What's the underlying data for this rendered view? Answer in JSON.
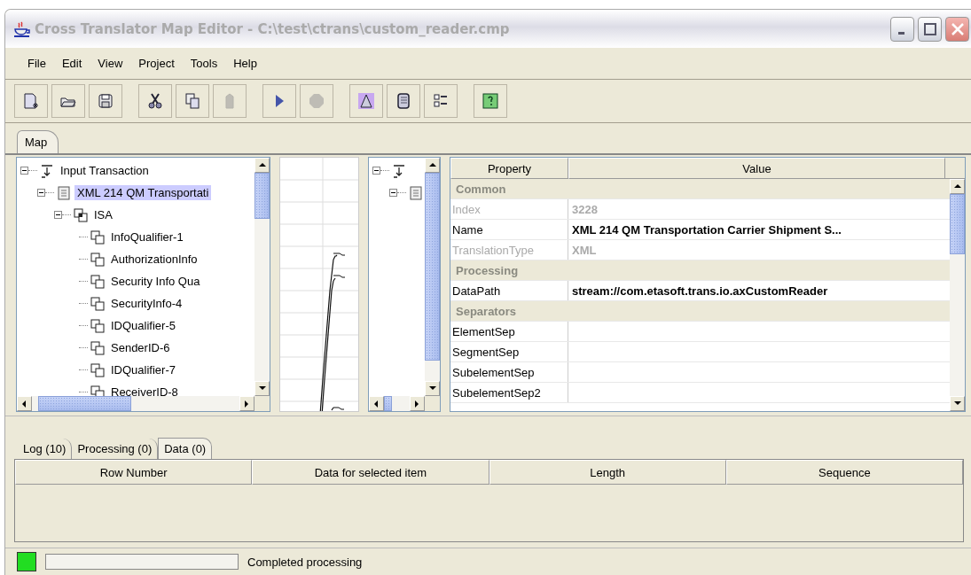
{
  "window": {
    "title": "Cross Translator Map Editor - C:\\test\\ctrans\\custom_reader.cmp"
  },
  "menu": [
    "File",
    "Edit",
    "View",
    "Project",
    "Tools",
    "Help"
  ],
  "toolbar": [
    {
      "kind": "new",
      "disabled": false
    },
    {
      "kind": "open",
      "disabled": false
    },
    {
      "kind": "save",
      "disabled": false
    },
    {
      "kind": "sep"
    },
    {
      "kind": "cut",
      "disabled": false
    },
    {
      "kind": "copy",
      "disabled": false
    },
    {
      "kind": "paste",
      "disabled": true
    },
    {
      "kind": "sep"
    },
    {
      "kind": "run",
      "disabled": false
    },
    {
      "kind": "stop",
      "disabled": true
    },
    {
      "kind": "sep"
    },
    {
      "kind": "map",
      "disabled": false
    },
    {
      "kind": "book",
      "disabled": false
    },
    {
      "kind": "list",
      "disabled": false
    },
    {
      "kind": "sep"
    },
    {
      "kind": "help",
      "disabled": false
    }
  ],
  "tabs": [
    {
      "label": "Map",
      "selected": true
    }
  ],
  "source_tree": [
    {
      "kind": "transaction",
      "label": "Input Transaction",
      "expanded": true,
      "selected": false,
      "children": [
        {
          "kind": "document",
          "label": "XML 214 QM Transportati",
          "expanded": true,
          "selected": true,
          "children": [
            {
              "kind": "segment",
              "label": "ISA",
              "expanded": true,
              "selected": false,
              "children": [
                {
                  "kind": "element",
                  "label": "InfoQualifier-1",
                  "selected": false
                },
                {
                  "kind": "element",
                  "label": "AuthorizationInfo",
                  "selected": false
                },
                {
                  "kind": "element",
                  "label": "Security Info Qua",
                  "selected": false
                },
                {
                  "kind": "element",
                  "label": "SecurityInfo-4",
                  "selected": false
                },
                {
                  "kind": "element",
                  "label": "IDQualifier-5",
                  "selected": false
                },
                {
                  "kind": "element",
                  "label": "SenderID-6",
                  "selected": false
                },
                {
                  "kind": "element",
                  "label": "IDQualifier-7",
                  "selected": false
                },
                {
                  "kind": "element",
                  "label": "ReceiverID-8",
                  "selected": false
                }
              ]
            }
          ]
        }
      ]
    }
  ],
  "target_tree": [
    {
      "kind": "transaction",
      "expanded": true,
      "children": [
        {
          "kind": "document",
          "expanded": true
        }
      ]
    }
  ],
  "properties": {
    "columns": [
      "Property",
      "Value"
    ],
    "rows": [
      {
        "kind": "category",
        "name": "Common"
      },
      {
        "kind": "property",
        "name": "Index",
        "value": "3228",
        "disabled": true
      },
      {
        "kind": "property",
        "name": "Name",
        "value": "XML 214 QM Transportation Carrier Shipment S...",
        "disabled": false
      },
      {
        "kind": "property",
        "name": "TranslationType",
        "value": "XML",
        "disabled": true
      },
      {
        "kind": "category",
        "name": "Processing"
      },
      {
        "kind": "property",
        "name": "DataPath",
        "value": "stream://com.etasoft.trans.io.axCustomReader",
        "disabled": false
      },
      {
        "kind": "category",
        "name": "Separators"
      },
      {
        "kind": "property",
        "name": "ElementSep",
        "disabled": false
      },
      {
        "kind": "property",
        "name": "SegmentSep",
        "disabled": false
      },
      {
        "kind": "property",
        "name": "SubelementSep",
        "disabled": false
      },
      {
        "kind": "property",
        "name": "SubelementSep2",
        "disabled": false
      }
    ]
  },
  "bottom_tabs": [
    {
      "label": "Log (10)",
      "selected": false
    },
    {
      "label": "Processing (0)",
      "selected": false
    },
    {
      "label": "Data (0)",
      "selected": true
    }
  ],
  "data_table": {
    "columns": [
      "Row Number",
      "Data for selected item",
      "Length",
      "Sequence"
    ]
  },
  "status_bar": {
    "color": "#22dd22",
    "level": 0,
    "message": "Completed processing"
  }
}
